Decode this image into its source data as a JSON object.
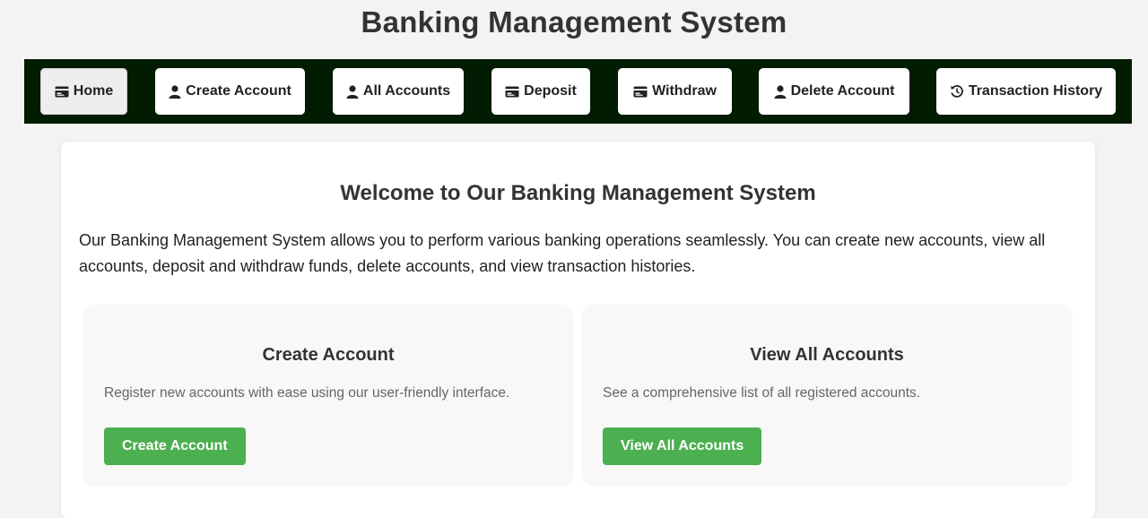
{
  "header": {
    "title": "Banking Management System"
  },
  "nav": {
    "items": [
      {
        "label": "Home",
        "icon": "card-icon"
      },
      {
        "label": "Create Account",
        "icon": "user-icon"
      },
      {
        "label": "All Accounts",
        "icon": "user-icon"
      },
      {
        "label": "Deposit",
        "icon": "card-icon"
      },
      {
        "label": "Withdraw",
        "icon": "card-icon"
      },
      {
        "label": "Delete Account",
        "icon": "user-icon"
      },
      {
        "label": "Transaction History",
        "icon": "history-icon"
      }
    ],
    "active": "Home"
  },
  "main": {
    "title": "Welcome to Our Banking Management System",
    "intro": "Our Banking Management System allows you to perform various banking operations seamlessly. You can create new accounts, view all accounts, deposit and withdraw funds, delete accounts, and view transaction histories.",
    "cards": [
      {
        "title": "Create Account",
        "description": "Register new accounts with ease using our user-friendly interface.",
        "button": "Create Account"
      },
      {
        "title": "View All Accounts",
        "description": "See a comprehensive list of all registered accounts.",
        "button": "View All Accounts"
      }
    ]
  },
  "colors": {
    "navbar_bg": "#011c01",
    "accent_green": "#4caf50",
    "page_bg": "#f3f3f3"
  }
}
